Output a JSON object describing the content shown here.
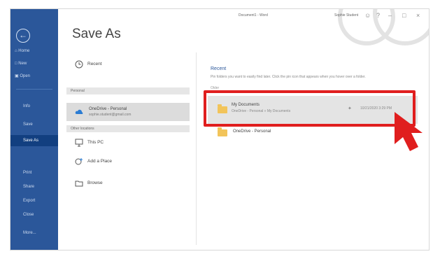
{
  "colors": {
    "sidebar": "#2b579a",
    "accent": "#2b579a",
    "highlight": "#e01e1e",
    "folder": "#f2c45a"
  },
  "titlebar": {
    "doc_title": "Document1 - Word",
    "user_name": "Sophie Student",
    "icons": [
      "smiley-icon",
      "help-icon",
      "minimize-icon",
      "restore-icon",
      "close-icon"
    ]
  },
  "sidebar": {
    "back_icon": "back-arrow-icon",
    "top_items": [
      {
        "label": "Home",
        "icon": "home-icon"
      },
      {
        "label": "New",
        "icon": "new-document-icon"
      },
      {
        "label": "Open",
        "icon": "open-folder-icon"
      }
    ],
    "items": [
      {
        "label": "Info",
        "active": false
      },
      {
        "label": "Save",
        "active": false
      },
      {
        "label": "Save As",
        "active": true
      },
      {
        "label": "Print",
        "active": false
      },
      {
        "label": "Share",
        "active": false
      },
      {
        "label": "Export",
        "active": false
      },
      {
        "label": "Close",
        "active": false
      },
      {
        "label": "More...",
        "active": false
      }
    ]
  },
  "page": {
    "title": "Save As"
  },
  "locations": {
    "recent_label": "Recent",
    "personal_header": "Personal",
    "onedrive": {
      "name": "OneDrive - Personal",
      "email": "sophie.student@gmail.com"
    },
    "other_header": "Other locations",
    "this_pc": "This PC",
    "add_place": "Add a Place",
    "browse": "Browse"
  },
  "recent_pane": {
    "title": "Recent",
    "description": "Pin folders you want to easily find later. Click the pin icon that appears when you hover over a folder.",
    "group_label": "Older",
    "folders": [
      {
        "name": "My Documents",
        "path": "OneDrive - Personal » My Documents",
        "date": "10/21/2020 3:29 PM",
        "highlighted": true
      },
      {
        "name": "OneDrive - Personal",
        "path": "",
        "date": "",
        "highlighted": false
      }
    ]
  }
}
